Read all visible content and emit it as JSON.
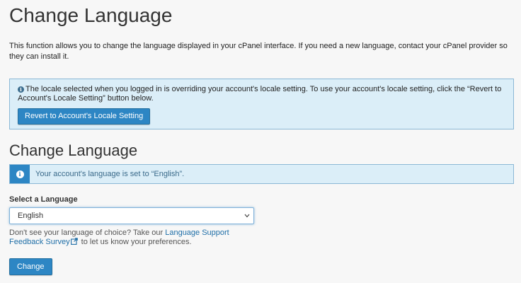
{
  "page": {
    "title": "Change Language",
    "description": "This function allows you to change the language displayed in your cPanel interface. If you need a new language, contact your cPanel provider so they can install it."
  },
  "locale_notice": {
    "icon": "info-icon",
    "text": "The locale selected when you logged in is overriding your account's locale setting. To use your account's locale setting, click the “Revert to Account's Locale Setting” button below.",
    "button_label": "Revert to Account's Locale Setting"
  },
  "section": {
    "title": "Change Language",
    "alert_icon": "info-icon",
    "alert_text": "Your account's language is set to “English”."
  },
  "language_select": {
    "label": "Select a Language",
    "selected_value": "English",
    "chevron_icon": "chevron-down-icon"
  },
  "help": {
    "prefix": "Don't see your language of choice? Take our ",
    "link_text": "Language Support Feedback Survey",
    "link_icon": "external-link-icon",
    "suffix": " to let us know your preferences."
  },
  "actions": {
    "change_label": "Change"
  },
  "colors": {
    "accent": "#2d86c4",
    "info_background": "#dbeef8",
    "info_border": "#8bb8d6",
    "link": "#1e6ea7"
  }
}
